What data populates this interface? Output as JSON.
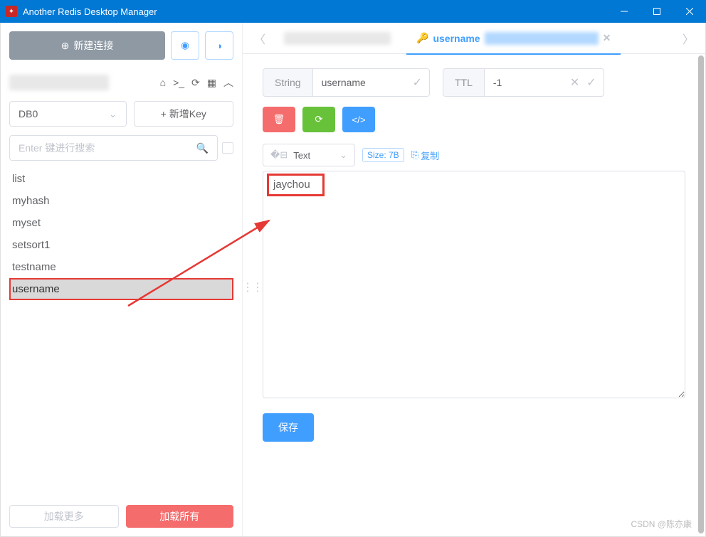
{
  "titlebar": {
    "title": "Another Redis Desktop Manager"
  },
  "sidebar": {
    "new_conn": "新建连接",
    "db_select": "DB0",
    "add_key": "新增Key",
    "search_placeholder": "Enter 键进行搜索",
    "keys": [
      "list",
      "myhash",
      "myset",
      "setsort1",
      "testname",
      "username"
    ],
    "selected_index": 5,
    "load_more": "加载更多",
    "load_all": "加载所有"
  },
  "tabs": {
    "active_label": "username"
  },
  "detail": {
    "type_label": "String",
    "key_name": "username",
    "ttl_label": "TTL",
    "ttl_value": "-1",
    "format": "Text",
    "size_badge": "Size: 7B",
    "copy_label": "复制",
    "value": "jaychou",
    "save": "保存"
  },
  "watermark": "CSDN @陈亦康"
}
